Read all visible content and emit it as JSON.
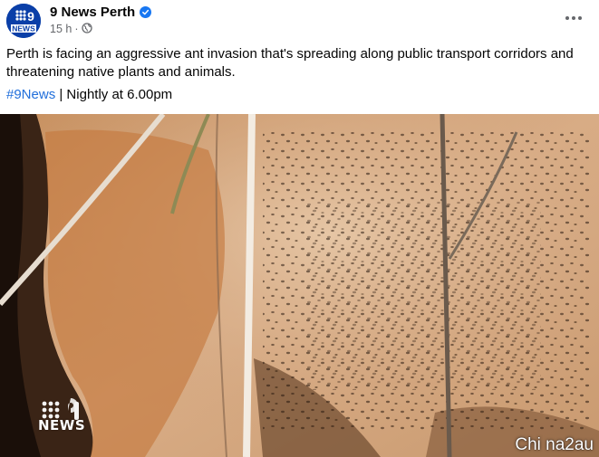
{
  "post": {
    "page_name": "9 News Perth",
    "verified_icon": "verified-badge-icon",
    "time": "15 h",
    "separator": "·",
    "audience_icon": "globe-icon",
    "more_icon": "more-options-icon",
    "avatar_text_top": "9",
    "avatar_text_bottom": "NEWS",
    "text": "Perth is facing an aggressive ant invasion that's spreading along public transport corridors and threatening native plants and animals.",
    "hashtag": "#9News",
    "tag_suffix": " | Nightly at 6.00pm"
  },
  "media": {
    "description_icon": "ant-video-still",
    "watermark_news": "NEWS",
    "corner_watermark": "Chi na2au"
  },
  "colors": {
    "link": "#216fdb",
    "verified": "#1877f2",
    "meta": "#65676b",
    "brand_blue": "#0a3fa8"
  }
}
